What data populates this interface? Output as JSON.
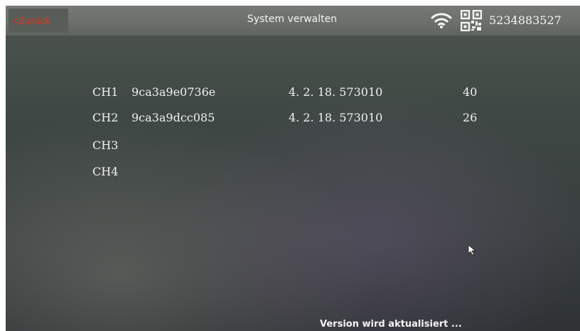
{
  "header": {
    "back_label": "<Zurück",
    "title": "System verwalten",
    "device_id": "5234883527",
    "icons": [
      "wifi-icon",
      "qr-code-icon"
    ],
    "accent_color": "#e2341d"
  },
  "channels": [
    {
      "name": "CH1",
      "mac": "9ca3a9e0736e",
      "version": "4. 2. 18. 573010",
      "value": "40"
    },
    {
      "name": "CH2",
      "mac": "9ca3a9dcc085",
      "version": "4. 2. 18. 573010",
      "value": "26"
    },
    {
      "name": "CH3",
      "mac": "",
      "version": "",
      "value": ""
    },
    {
      "name": "CH4",
      "mac": "",
      "version": "",
      "value": ""
    }
  ],
  "status_text": "Version wird aktualisiert ...",
  "cursor_icon": "mouse-pointer-icon"
}
